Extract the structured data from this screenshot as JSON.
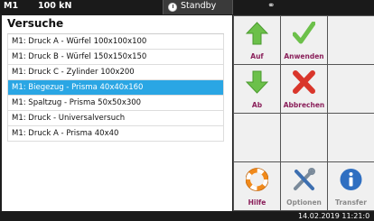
{
  "status": {
    "machine": "M1",
    "force": "100 kN",
    "mode": "Standby"
  },
  "panel": {
    "title": "Versuche",
    "items": [
      "M1: Druck A - Würfel 100x100x100",
      "M1: Druck B - Würfel 150x150x150",
      "M1: Druck C - Zylinder 100x200",
      "M1: Biegezug - Prisma 40x40x160",
      "M1: Spaltzug - Prisma 50x50x300",
      "M1: Druck - Universalversuch",
      "M1: Druck A - Prisma 40x40"
    ],
    "selected_index": 3
  },
  "actions": {
    "up": "Auf",
    "apply": "Anwenden",
    "down": "Ab",
    "cancel": "Abbrechen",
    "help": "Hilfe",
    "options": "Optionen",
    "transfer": "Transfer"
  },
  "footer": {
    "datetime": "14.02.2019 11:21:0"
  },
  "colors": {
    "selection": "#2aa6e4",
    "label": "#8a1f5a",
    "green": "#6cc04a",
    "red": "#d9362b"
  }
}
